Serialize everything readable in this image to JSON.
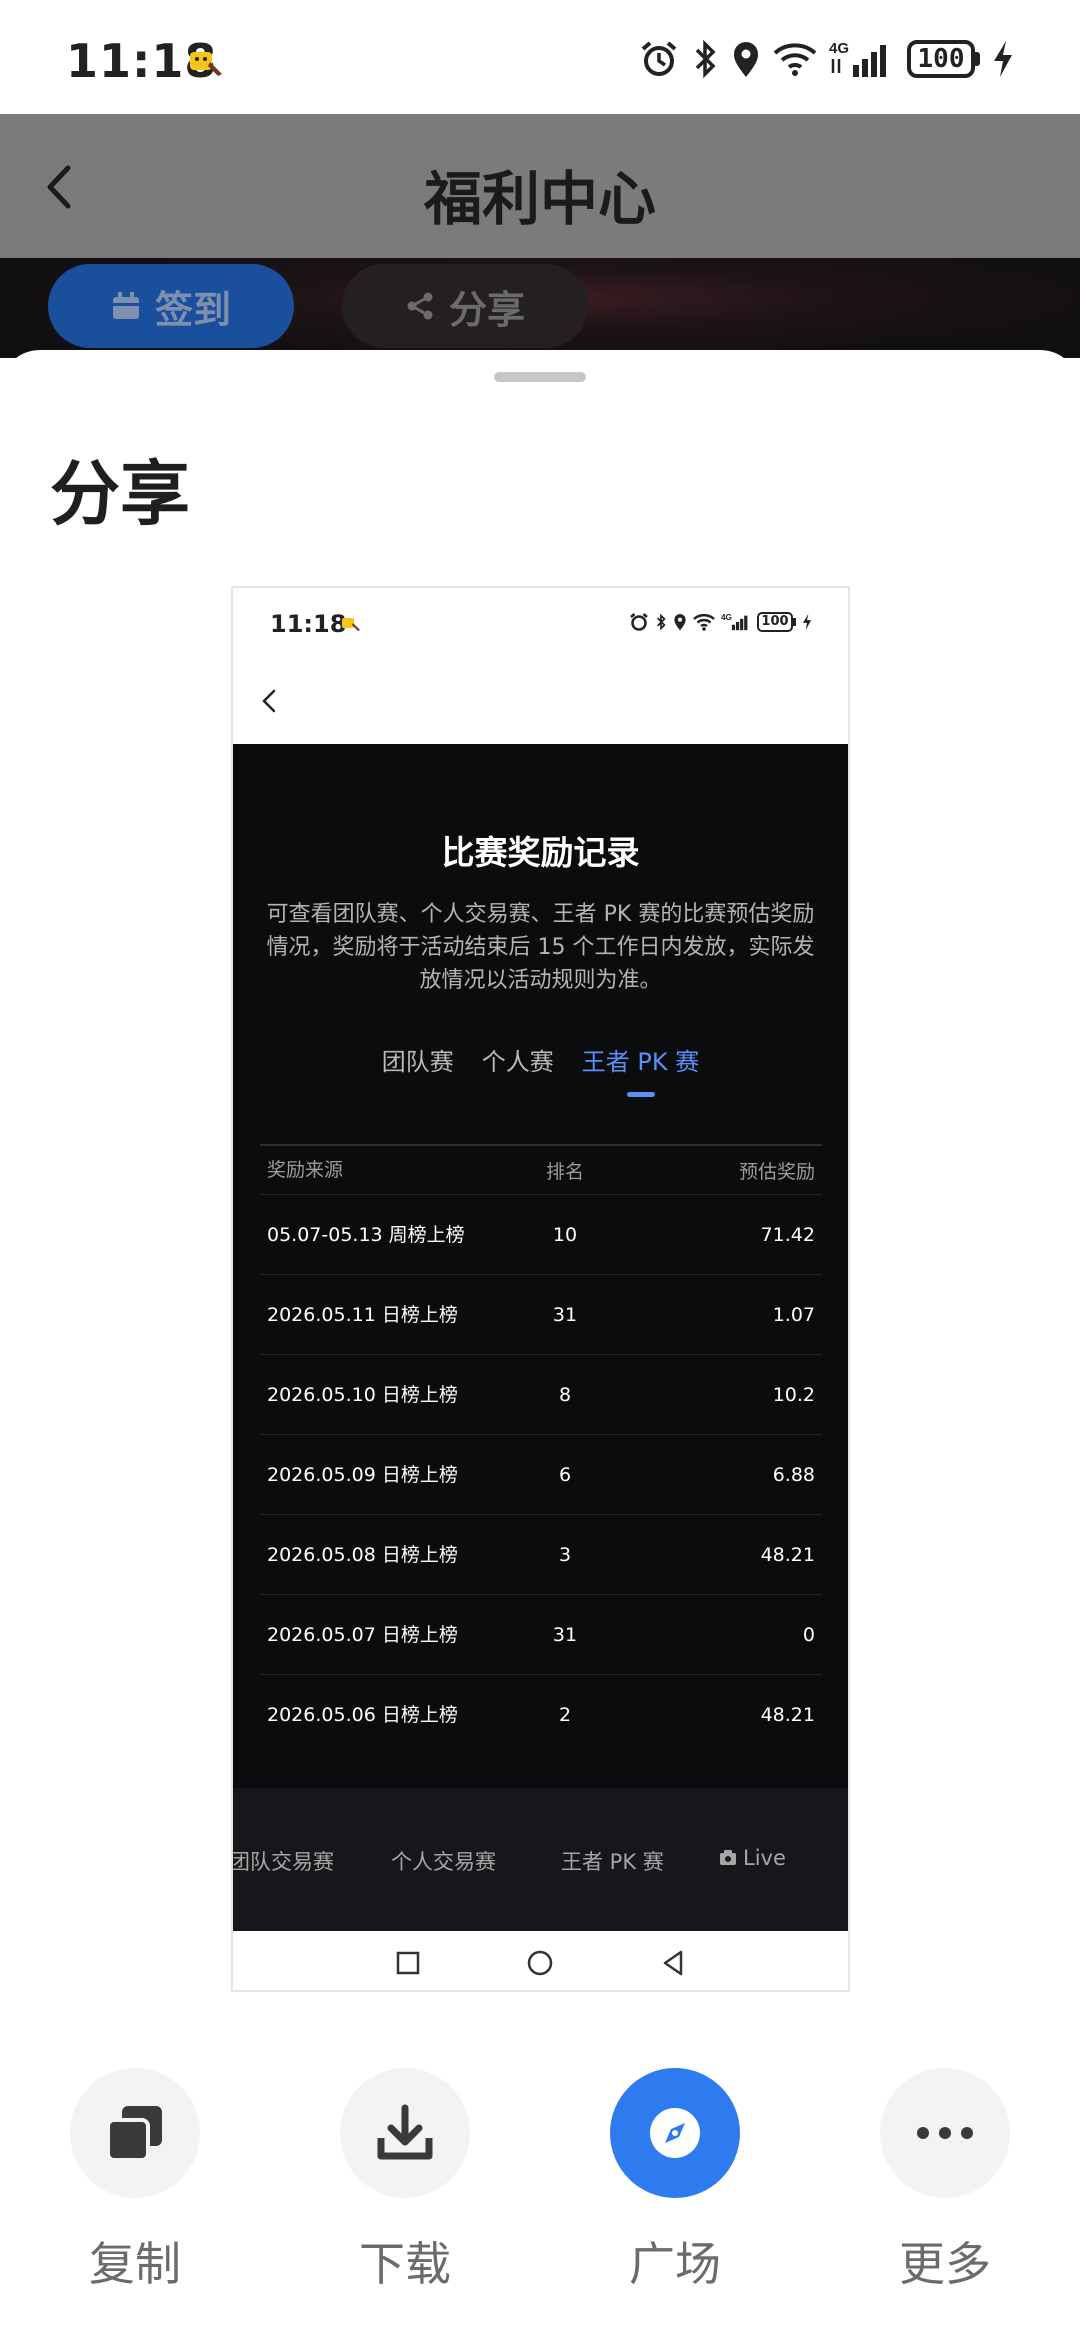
{
  "status_bar": {
    "time": "11:18",
    "battery": "100",
    "network": "4G"
  },
  "background_page": {
    "title": "福利中心",
    "sign_in_label": "签到",
    "share_label": "分享"
  },
  "share_sheet": {
    "title": "分享",
    "preview": {
      "status_time": "11:18",
      "status_battery": "100",
      "heading": "比赛奖励记录",
      "description": "可查看团队赛、个人交易赛、王者 PK 赛的比赛预估奖励情况，奖励将于活动结束后 15 个工作日内发放，实际发放情况以活动规则为准。",
      "tabs": [
        {
          "label": "团队赛",
          "active": false
        },
        {
          "label": "个人赛",
          "active": false
        },
        {
          "label": "王者 PK 赛",
          "active": true
        }
      ],
      "table": {
        "headers": [
          "奖励来源",
          "排名",
          "预估奖励"
        ],
        "rows": [
          {
            "source": "05.07-05.13 周榜上榜",
            "rank": "10",
            "reward": "71.42"
          },
          {
            "source": "2026.05.11 日榜上榜",
            "rank": "31",
            "reward": "1.07"
          },
          {
            "source": "2026.05.10 日榜上榜",
            "rank": "8",
            "reward": "10.2"
          },
          {
            "source": "2026.05.09 日榜上榜",
            "rank": "6",
            "reward": "6.88"
          },
          {
            "source": "2026.05.08 日榜上榜",
            "rank": "3",
            "reward": "48.21"
          },
          {
            "source": "2026.05.07 日榜上榜",
            "rank": "31",
            "reward": "0"
          },
          {
            "source": "2026.05.06 日榜上榜",
            "rank": "2",
            "reward": "48.21"
          }
        ]
      },
      "bottom_nav": [
        "团队交易赛",
        "个人交易赛",
        "王者 PK 赛",
        "Live"
      ]
    },
    "actions": [
      {
        "label": "复制",
        "icon": "copy-icon"
      },
      {
        "label": "下载",
        "icon": "download-icon"
      },
      {
        "label": "广场",
        "icon": "compass-icon"
      },
      {
        "label": "更多",
        "icon": "more-icon"
      }
    ]
  },
  "colors": {
    "accent_blue": "#2e7bf0",
    "tab_active": "#5b8ff9",
    "preview_dark_bg": "#0b0c0d",
    "dim_header": "#7b7b7b"
  }
}
